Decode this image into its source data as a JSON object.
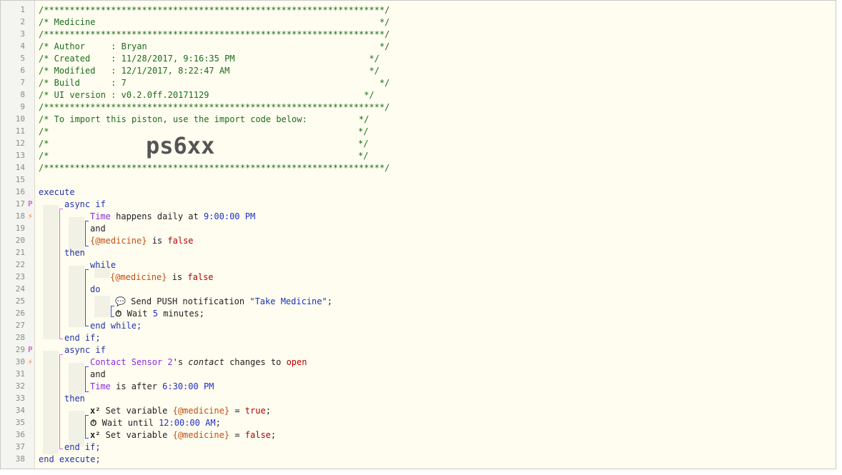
{
  "line_numbers": [
    "1",
    "2",
    "3",
    "4",
    "5",
    "6",
    "7",
    "8",
    "9",
    "10",
    "11",
    "12",
    "13",
    "14",
    "15",
    "16",
    "17",
    "18",
    "19",
    "20",
    "21",
    "22",
    "23",
    "24",
    "25",
    "26",
    "27",
    "28",
    "29",
    "30",
    "31",
    "32",
    "33",
    "34",
    "35",
    "36",
    "37",
    "38"
  ],
  "gutter_marks": {
    "if1": "P",
    "trig1": "⚡",
    "if2": "P",
    "trig2": "⚡"
  },
  "header": {
    "stars": "/******************************************************************/",
    "title": "/* Medicine                                                       */",
    "author": "/* Author     : Bryan                                             */",
    "created": "/* Created    : 11/28/2017, 9:16:35 PM                          */",
    "modified": "/* Modified   : 12/1/2017, 8:22:47 AM                           */",
    "build": "/* Build      : 7                                                 */",
    "ui_version": "/* UI version : v0.2.0ff.20171129                              */",
    "import_text": "/* To import this piston, use the import code below:          */",
    "blank_left": "/*",
    "blank_right": "*/",
    "import_code": "ps6xx"
  },
  "code": {
    "execute": "execute",
    "async_if": "async if",
    "time": "Time",
    "happens_daily_at": " happens daily at ",
    "time_900": "9:00:00 PM",
    "and": "and",
    "medicine_var": "{@medicine}",
    "is": " is ",
    "false": "false",
    "then": "then",
    "while": "while",
    "do": "do",
    "speech_icon": "💬",
    "send_push": " Send PUSH notification ",
    "take_medicine": "\"Take Medicine\"",
    "semicolon": ";",
    "clock_icon": "⏱",
    "wait": " Wait ",
    "five": "5",
    "minutes": " minutes;",
    "end_while": "end while;",
    "end_if": "end if;",
    "contact_sensor": "Contact Sensor 2",
    "apostrophe_s": "'s ",
    "contact": "contact",
    "changes_to": " changes to ",
    "open": "open",
    "is_after": " is after ",
    "time_630": "6:30:00 PM",
    "x2_icon": "x²",
    "set_variable": " Set variable ",
    "equals": " = ",
    "true": "true",
    "wait_until": " Wait until ",
    "time_1200": "12:00:00 AM",
    "end_execute": "end execute;"
  }
}
